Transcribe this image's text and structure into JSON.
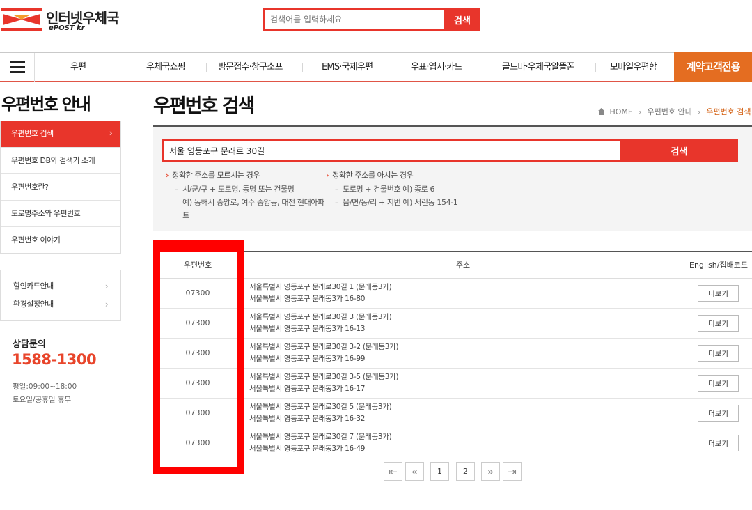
{
  "header": {
    "logo_title": "인터넷우체국",
    "logo_sub": "ePOST kr",
    "search_placeholder": "검색어를 입력하세요",
    "search_button": "검색"
  },
  "gnb": {
    "items": [
      "우편",
      "우체국쇼핑",
      "방문접수·창구소포",
      "EMS·국제우편",
      "우표·엽서·카드",
      "골드바·우체국알뜰폰",
      "모바일우편함"
    ],
    "special": "계약고객전용"
  },
  "sidebar": {
    "title": "우편번호 안내",
    "items": [
      {
        "label": "우편번호 검색",
        "active": true
      },
      {
        "label": "우편번호 DB와 검색기 소개"
      },
      {
        "label": "우편번호란?"
      },
      {
        "label": "도로명주소와 우편번호"
      },
      {
        "label": "우편번호 이야기"
      }
    ],
    "links": [
      "할인카드안내",
      "환경설정안내"
    ],
    "cs": {
      "title": "상담문의",
      "phone": "1588-1300",
      "hours_weekday": "평일:09:00~18:00",
      "hours_holiday": "토요일/공휴일 휴무"
    }
  },
  "main": {
    "title": "우편번호 검색",
    "breadcrumb": [
      "HOME",
      "우편번호 안내",
      "우편번호 검색"
    ],
    "search_value": "서울 영등포구 문래로 30길",
    "search_button": "검색",
    "guide_left": {
      "head": "정확한 주소를 모르시는 경우",
      "line1": "시/군/구 + 도로명, 동명 또는 건물명",
      "line2": "예) 동해시 중앙로, 여수 중앙동, 대전 현대아파",
      "line3": "트"
    },
    "guide_right": {
      "head": "정확한 주소를 아시는 경우",
      "line1": "도로명 + 건물번호 예) 종로 6",
      "line2": "읍/면/동/리 + 지번 예) 서린동 154-1"
    },
    "table": {
      "headers": [
        "우편번호",
        "주소",
        "English/집배코드"
      ],
      "more_label": "더보기",
      "rows": [
        {
          "code": "07300",
          "road": "서울특별시 영등포구 문래로30길 1 (문래동3가)",
          "jibun": "서울특별시 영등포구 문래동3가 16-80"
        },
        {
          "code": "07300",
          "road": "서울특별시 영등포구 문래로30길 3 (문래동3가)",
          "jibun": "서울특별시 영등포구 문래동3가 16-13"
        },
        {
          "code": "07300",
          "road": "서울특별시 영등포구 문래로30길 3-2 (문래동3가)",
          "jibun": "서울특별시 영등포구 문래동3가 16-99"
        },
        {
          "code": "07300",
          "road": "서울특별시 영등포구 문래로30길 3-5 (문래동3가)",
          "jibun": "서울특별시 영등포구 문래동3가 16-17"
        },
        {
          "code": "07300",
          "road": "서울특별시 영등포구 문래로30길 5 (문래동3가)",
          "jibun": "서울특별시 영등포구 문래동3가 16-32"
        },
        {
          "code": "07300",
          "road": "서울특별시 영등포구 문래로30길 7 (문래동3가)",
          "jibun": "서울특별시 영등포구 문래동3가 16-49"
        }
      ]
    },
    "pager": {
      "first": "|<",
      "prev": "«",
      "pages": [
        "1",
        "2"
      ],
      "current_page": "1",
      "next": "»",
      "last": ">|"
    }
  },
  "colors": {
    "accent_red": "#e8352b",
    "gnb_orange": "#e46d21",
    "highlight_red": "#ff0000"
  }
}
